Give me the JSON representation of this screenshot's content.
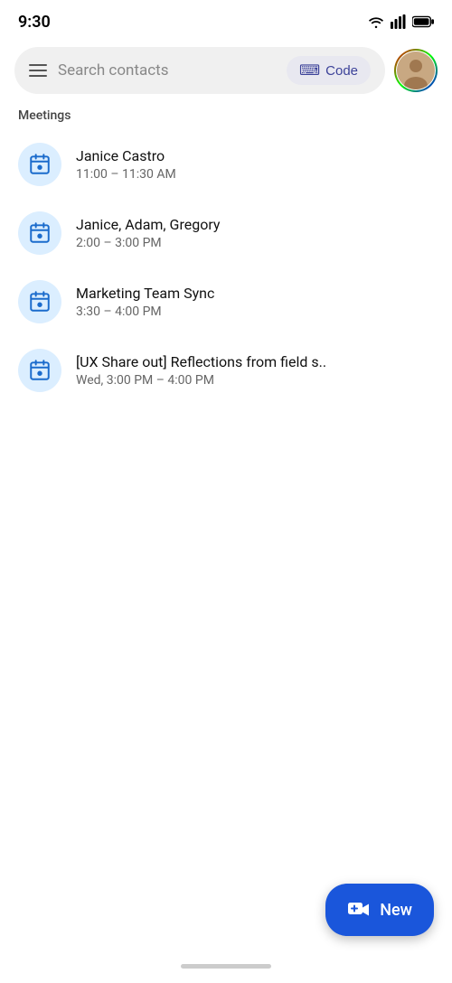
{
  "statusBar": {
    "time": "9:30"
  },
  "searchBar": {
    "placeholder": "Search contacts",
    "codeLabel": "Code"
  },
  "section": {
    "label": "Meetings"
  },
  "meetings": [
    {
      "title": "Janice Castro",
      "time": "11:00 – 11:30 AM"
    },
    {
      "title": "Janice, Adam, Gregory",
      "time": "2:00 – 3:00 PM"
    },
    {
      "title": "Marketing Team Sync",
      "time": "3:30 – 4:00 PM"
    },
    {
      "title": "[UX Share out] Reflections from field s..",
      "time": "Wed, 3:00 PM –  4:00 PM"
    }
  ],
  "fab": {
    "label": "New"
  }
}
